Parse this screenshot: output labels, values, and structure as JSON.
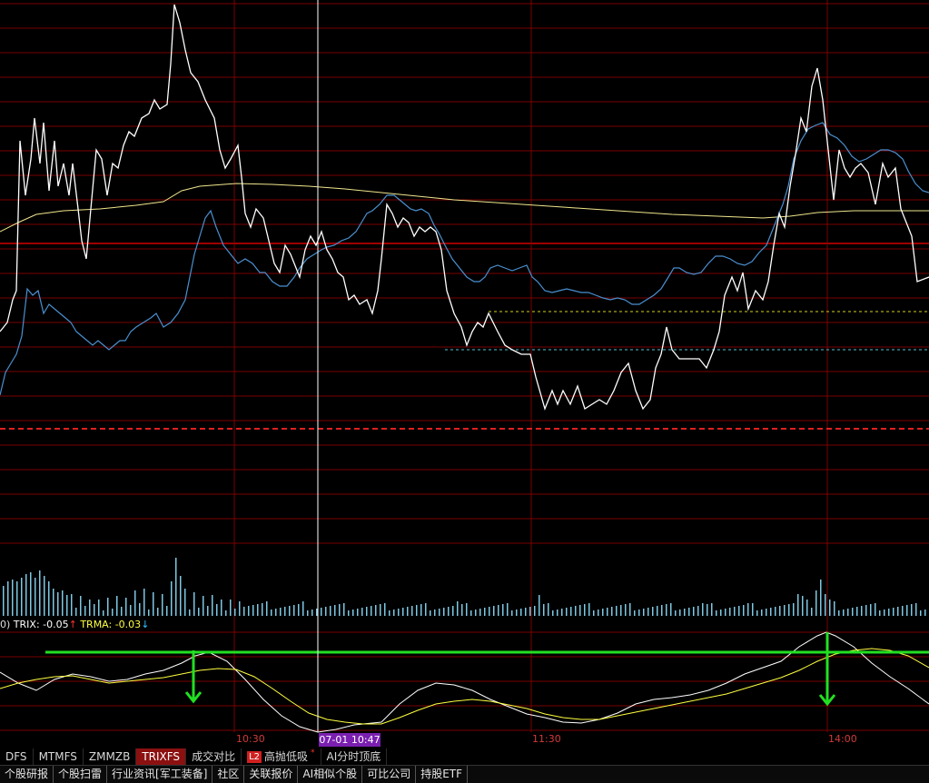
{
  "indicator": {
    "prefix": "0)",
    "trix_label": "TRIX: -0.05",
    "trix_arrow": "↑",
    "trma_label": "TRMA: -0.03",
    "trma_arrow": "↓",
    "trix_color": "#ffffff",
    "trma_color": "#ffff40",
    "arrow_up_color": "#ff3030",
    "arrow_down_color": "#30c0ff"
  },
  "time_axis": {
    "labels": [
      "10:30",
      "11:30",
      "14:00"
    ],
    "cursor_time": "07-01 10:47"
  },
  "indicator_tabs": [
    {
      "label": "DFS",
      "active": false
    },
    {
      "label": "MTMFS",
      "active": false
    },
    {
      "label": "ZMMZB",
      "active": false
    },
    {
      "label": "TRIXFS",
      "active": true
    },
    {
      "label": "成交对比",
      "active": false
    },
    {
      "label": "高抛低吸",
      "active": false,
      "badge": "L2",
      "dot": "*"
    },
    {
      "label": "AI分时顶底",
      "active": false
    }
  ],
  "bottom_links": [
    "个股研报",
    "个股扫雷",
    "行业资讯[军工装备]",
    "社区",
    "关联报价",
    "AI相似个股",
    "可比公司",
    "持股ETF"
  ],
  "colors": {
    "grid": "#7a0000",
    "price_line": "#ffffff",
    "avg_line": "#f0e68c",
    "blue_line": "#4a90d0",
    "prev_close": "#e02020",
    "green_annotation": "#22e022",
    "volume_bar": "#7ec8e3"
  },
  "icons": [
    "up-arrow-icon",
    "down-arrow-icon",
    "green-down-arrow-icon"
  ]
}
